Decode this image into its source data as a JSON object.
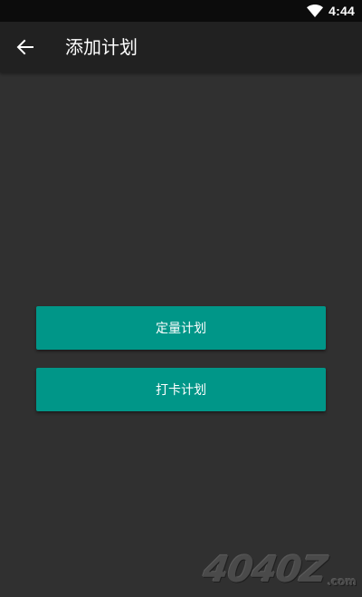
{
  "status_bar": {
    "time": "4:44",
    "wifi_icon": "wifi-icon"
  },
  "app_bar": {
    "back_icon": "arrow-back-icon",
    "title": "添加计划"
  },
  "buttons": {
    "quantitative_plan": "定量计划",
    "checkin_plan": "打卡计划"
  },
  "watermark": {
    "main": "4040Z",
    "suffix": ".com"
  },
  "colors": {
    "background": "#303030",
    "app_bar": "#212121",
    "status_bar": "#0c0c0c",
    "accent": "#009688",
    "text": "#ffffff"
  }
}
